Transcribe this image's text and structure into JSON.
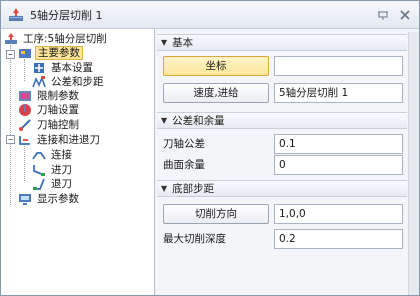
{
  "window": {
    "title": "5轴分层切削 1",
    "pin_icon": "pin-icon",
    "close_icon": "close-icon"
  },
  "tree": {
    "items": [
      {
        "label": "工序:5轴分层切削",
        "icon": "operation-icon"
      },
      {
        "label": "主要参数",
        "icon": "main-params-icon"
      },
      {
        "label": "基本设置",
        "icon": "basic-settings-icon"
      },
      {
        "label": "公差和步距",
        "icon": "tolerance-icon"
      },
      {
        "label": "限制参数",
        "icon": "limit-icon"
      },
      {
        "label": "刀轴设置",
        "icon": "tool-axis-icon"
      },
      {
        "label": "刀轴控制",
        "icon": "axis-control-icon"
      },
      {
        "label": "连接和进退刀",
        "icon": "link-icon"
      },
      {
        "label": "连接",
        "icon": "connect-icon"
      },
      {
        "label": "进刀",
        "icon": "lead-in-icon"
      },
      {
        "label": "退刀",
        "icon": "lead-out-icon"
      },
      {
        "label": "显示参数",
        "icon": "display-params-icon"
      }
    ],
    "expander_symbol": "−"
  },
  "sections": {
    "basic": {
      "header": "基本",
      "coord_button": "坐标",
      "coord_value": "",
      "feed_button": "速度,进给",
      "feed_value": "5轴分层切削 1"
    },
    "tolerance": {
      "header": "公差和余量",
      "tool_tol_label": "刀轴公差",
      "tool_tol_value": "0.1",
      "surface_allow_label": "曲面余量",
      "surface_allow_value": "0"
    },
    "bottom": {
      "header": "底部步距",
      "cut_dir_button": "切削方向",
      "cut_dir_value": "1,0,0",
      "max_depth_label": "最大切削深度",
      "max_depth_value": "0.2"
    }
  },
  "colors": {
    "selection": "#fde59a",
    "panel_bg": "#f3f5f8"
  }
}
